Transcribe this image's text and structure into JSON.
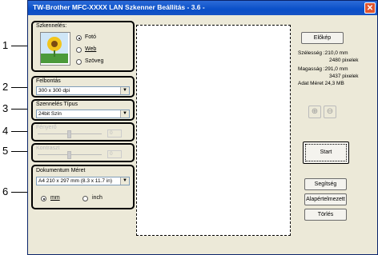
{
  "window": {
    "title": "TW-Brother MFC-XXXX  LAN Szkenner Beállítás - 3.6 -",
    "close_icon": "close-icon"
  },
  "callouts": [
    "1",
    "2",
    "3",
    "4",
    "5",
    "6"
  ],
  "scan_type": {
    "label": "Szkennelés:",
    "options": [
      "Fotó",
      "Web",
      "Szöveg"
    ],
    "selected": "Fotó"
  },
  "resolution": {
    "label": "Felbontás",
    "value": "300 x 300 dpi"
  },
  "scan_mode": {
    "label": "Szennelés Típus",
    "value": "24bit Szín"
  },
  "brightness": {
    "label": "Fényerő",
    "value": "0"
  },
  "contrast": {
    "label": "Kontraszt",
    "value": "0"
  },
  "document_size": {
    "label": "Dokumentum Méret",
    "value": "A4 210 x 297 mm (8.3 x 11.7 in)",
    "units": [
      "mm",
      "inch"
    ],
    "selected_unit": "mm"
  },
  "right_panel": {
    "preview_button": "Előkép",
    "width_label": "Szélesség :210,0 mm",
    "width_pixels": "2480 pixelek",
    "height_label": "Magasság :291,0 mm",
    "height_pixels": "3437 pixelek",
    "data_size": "Adat Méret   24,3 MB",
    "start_button": "Start",
    "help_button": "Segítség",
    "default_button": "Alapértelmezett",
    "clear_button": "Törlés"
  },
  "colors": {
    "titlebar": "#0a4fc8",
    "window_bg": "#ece9d8",
    "close": "#e0542e"
  }
}
